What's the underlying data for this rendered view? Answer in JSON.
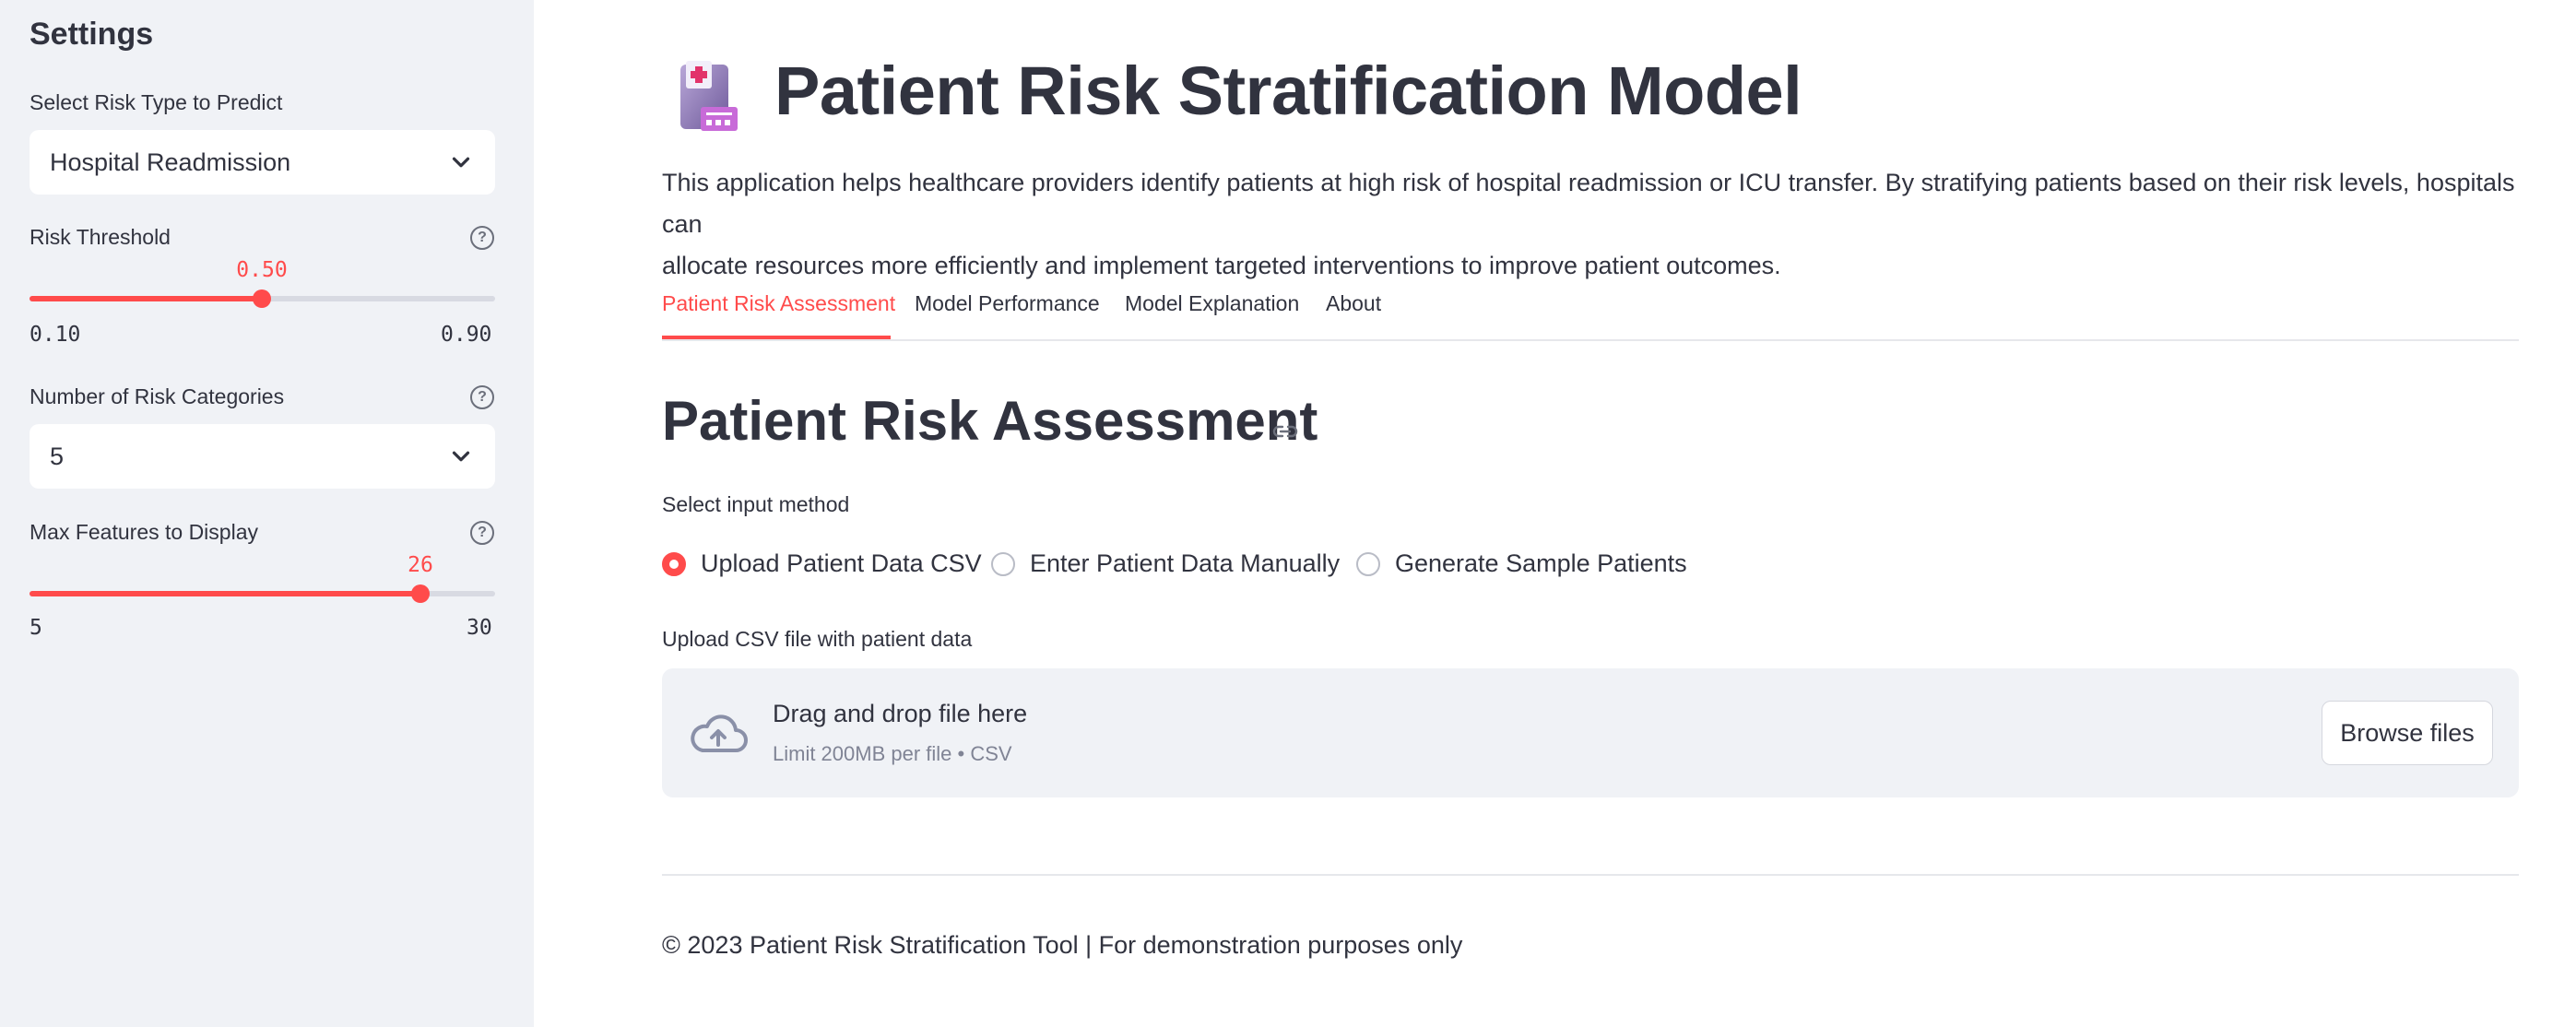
{
  "sidebar": {
    "title": "Settings",
    "risk_type": {
      "label": "Select Risk Type to Predict",
      "value": "Hospital Readmission"
    },
    "threshold": {
      "label": "Risk Threshold",
      "value": "0.50",
      "min": "0.10",
      "max": "0.90",
      "fraction": 0.5
    },
    "categories": {
      "label": "Number of Risk Categories",
      "value": "5"
    },
    "max_features": {
      "label": "Max Features to Display",
      "value": "26",
      "min": "5",
      "max": "30",
      "fraction": 0.84
    },
    "help_glyph": "?"
  },
  "main": {
    "title": "Patient Risk Stratification Model",
    "title_icon": "clipboard-medical-icon",
    "intro_line1": "This application helps healthcare providers identify patients at high risk of hospital readmission or ICU transfer. By stratifying patients based on their risk levels, hospitals can",
    "intro_line2": "allocate resources more efficiently and implement targeted interventions to improve patient outcomes.",
    "tabs": [
      {
        "label": "Patient Risk Assessment",
        "active": true
      },
      {
        "label": "Model Performance",
        "active": false
      },
      {
        "label": "Model Explanation",
        "active": false
      },
      {
        "label": "About",
        "active": false
      }
    ],
    "section_title": "Patient Risk Assessment",
    "input_method": {
      "label": "Select input method",
      "options": [
        "Upload Patient Data CSV",
        "Enter Patient Data Manually",
        "Generate Sample Patients"
      ],
      "selected": "Upload Patient Data CSV"
    },
    "uploader": {
      "label": "Upload CSV file with patient data",
      "drop_text": "Drag and drop file here",
      "limit_text": "Limit 200MB per file • CSV",
      "browse_label": "Browse files"
    },
    "footer": "© 2023 Patient Risk Stratification Tool | For demonstration purposes only"
  },
  "colors": {
    "accent": "#ff4b4b",
    "sidebar_bg": "#f0f2f6",
    "text": "#31333f"
  }
}
